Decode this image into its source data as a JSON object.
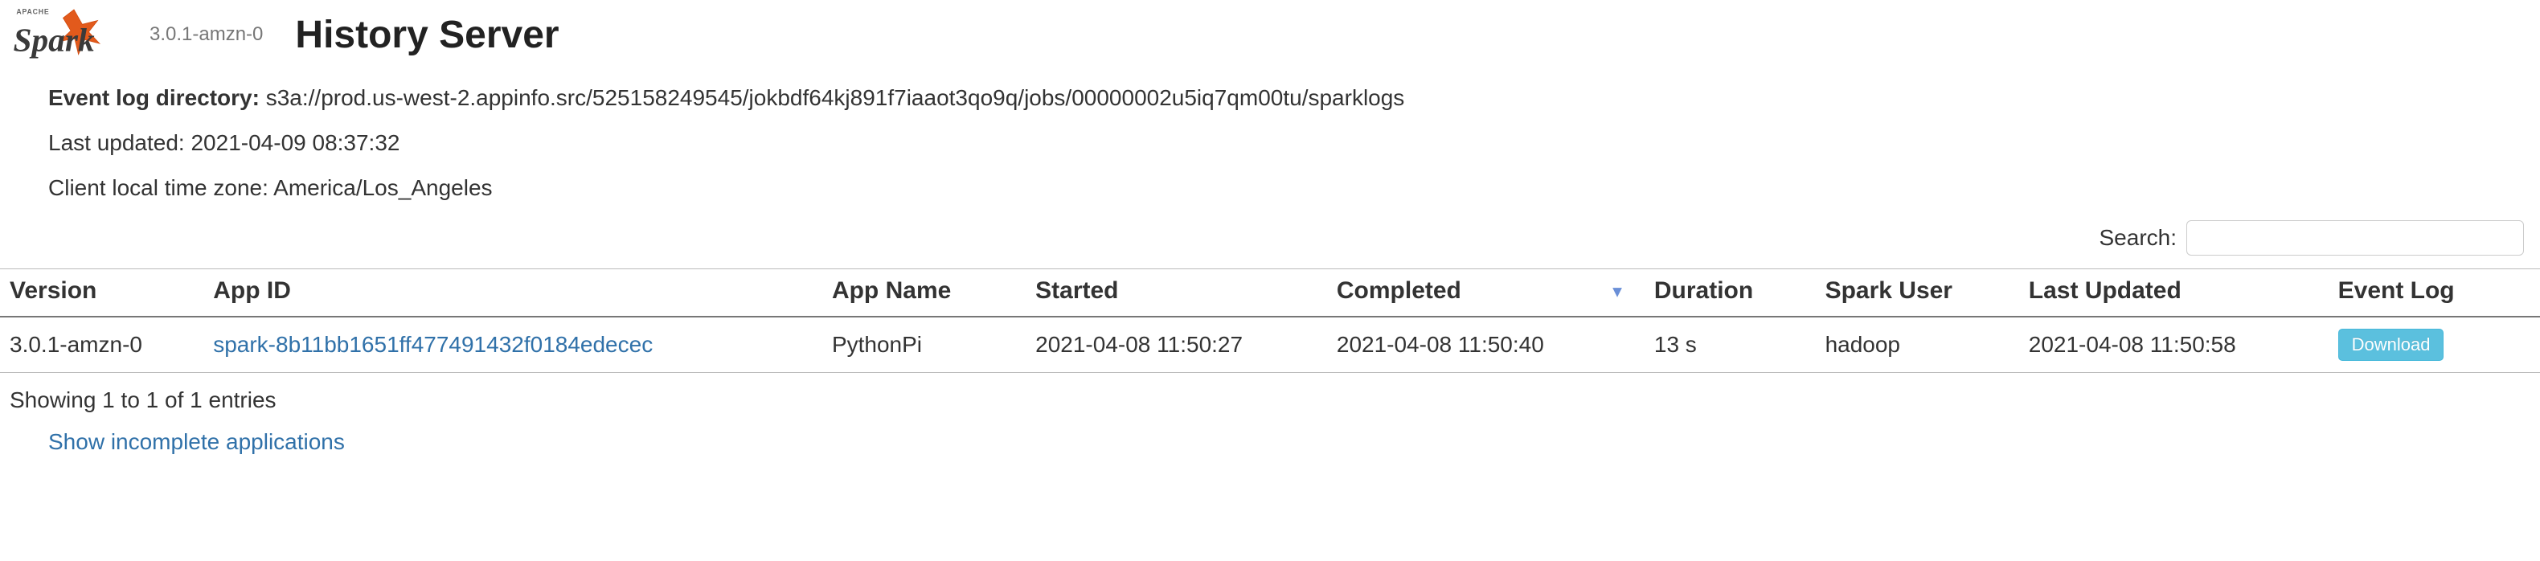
{
  "header": {
    "spark_version": "3.0.1-amzn-0",
    "page_title": "History Server",
    "apache_text": "APACHE"
  },
  "info": {
    "event_log_label": "Event log directory:",
    "event_log_value": "s3a://prod.us-west-2.appinfo.src/525158249545/jokbdf64kj891f7iaaot3qo9q/jobs/00000002u5iq7qm00tu/sparklogs",
    "last_updated_label": "Last updated:",
    "last_updated_value": "2021-04-09 08:37:32",
    "timezone_label": "Client local time zone:",
    "timezone_value": "America/Los_Angeles"
  },
  "search": {
    "label": "Search:",
    "value": ""
  },
  "table": {
    "headers": {
      "version": "Version",
      "app_id": "App ID",
      "app_name": "App Name",
      "started": "Started",
      "completed": "Completed",
      "duration": "Duration",
      "spark_user": "Spark User",
      "last_updated": "Last Updated",
      "event_log": "Event Log"
    },
    "rows": [
      {
        "version": "3.0.1-amzn-0",
        "app_id": "spark-8b11bb1651ff477491432f0184edecec",
        "app_name": "PythonPi",
        "started": "2021-04-08 11:50:27",
        "completed": "2021-04-08 11:50:40",
        "duration": "13 s",
        "spark_user": "hadoop",
        "last_updated": "2021-04-08 11:50:58",
        "download_label": "Download"
      }
    ]
  },
  "footer": {
    "showing": "Showing 1 to 1 of 1 entries",
    "incomplete_link": "Show incomplete applications"
  }
}
